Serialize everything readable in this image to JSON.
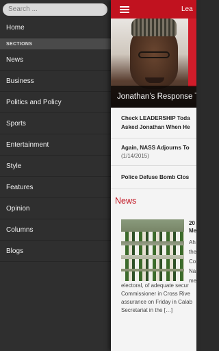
{
  "search": {
    "placeholder": "Search ..."
  },
  "sidebar": {
    "home_label": "Home",
    "section_header": "SECTIONS",
    "items": [
      {
        "label": "News"
      },
      {
        "label": "Business"
      },
      {
        "label": "Politics and Policy"
      },
      {
        "label": "Sports"
      },
      {
        "label": "Entertainment"
      },
      {
        "label": "Style"
      },
      {
        "label": "Features"
      },
      {
        "label": "Opinion"
      },
      {
        "label": "Columns"
      },
      {
        "label": "Blogs"
      }
    ]
  },
  "header": {
    "brand_partial": "Lea",
    "icon": "hamburger-menu-icon"
  },
  "hero": {
    "caption_partial": "Jonathan’s Response T"
  },
  "articles": [
    {
      "title_line1": "Check LEADERSHIP Toda",
      "title_line2": "Asked Jonathan When He"
    },
    {
      "title_line1": "Again, NASS Adjourns To",
      "date": "(1/14/2015)"
    },
    {
      "title_line1": "Police Defuse Bomb Clos"
    }
  ],
  "news": {
    "section_title": "News",
    "headline_line1": "20",
    "headline_line2": "Me",
    "side_lines": [
      "Ah",
      "the",
      "Co",
      "Na",
      "me"
    ],
    "excerpt_lines": [
      "electoral, of adequate secur",
      "Commissioner in Cross Rive",
      "assurance on Friday in Calab",
      "Secretariat in the […]"
    ]
  },
  "colors": {
    "accent": "#c1121f",
    "drawer_bg": "#2f2f2f",
    "section_header_bg": "#4a4a4a"
  }
}
